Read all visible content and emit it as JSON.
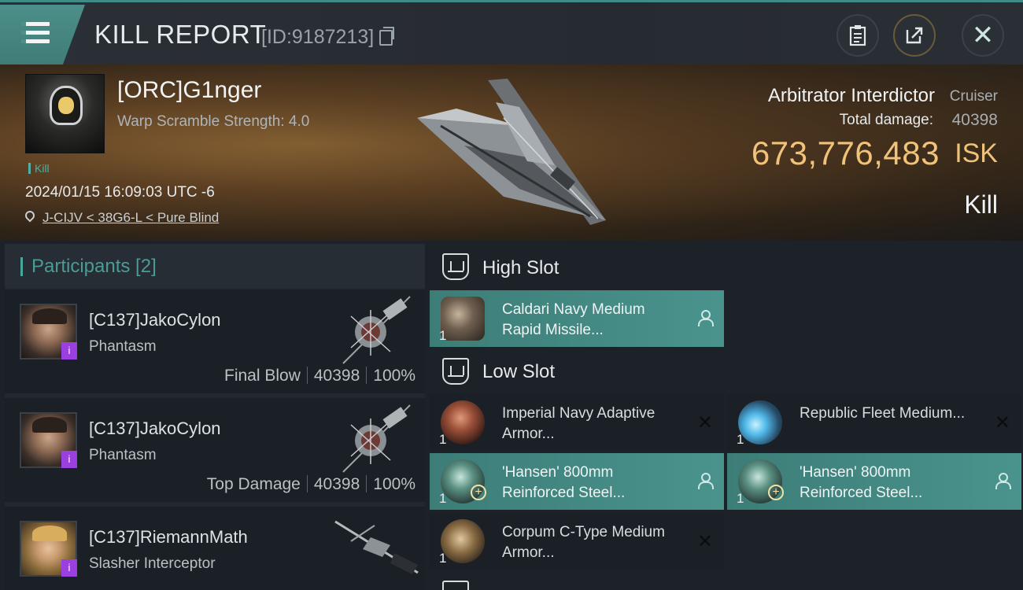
{
  "header": {
    "title": "KILL REPORT",
    "report_id": "[ID:9187213]",
    "close_glyph": "✕"
  },
  "hero": {
    "pilot_name": "[ORC]G1nger",
    "warp_scramble": "Warp Scramble Strength: 4.0",
    "kill_tag": "Kill",
    "datetime": "2024/01/15 16:09:03 UTC -6",
    "location": "J-CIJV < 38G6-L < Pure Blind",
    "ship_name": "Arbitrator Interdictor",
    "ship_class": "Cruiser",
    "total_damage_label": "Total damage:",
    "total_damage": "40398",
    "isk_value": "673,776,483",
    "isk_unit": "ISK",
    "status": "Kill"
  },
  "participants": {
    "title": "Participants [2]",
    "items": [
      {
        "name": "[C137]JakoCylon",
        "ship": "Phantasm",
        "role": "Final Blow",
        "damage": "40398",
        "percent": "100%"
      },
      {
        "name": "[C137]JakoCylon",
        "ship": "Phantasm",
        "role": "Top Damage",
        "damage": "40398",
        "percent": "100%"
      },
      {
        "name": "[C137]RiemannMath",
        "ship": "Slasher Interceptor",
        "role": "",
        "damage": "",
        "percent": ""
      }
    ]
  },
  "fitting": {
    "high_slot": {
      "title": "High Slot",
      "modules": [
        {
          "name": "Caldari Navy Medium Rapid Missile...",
          "qty": "1",
          "state": "dropped"
        }
      ]
    },
    "low_slot": {
      "title": "Low Slot",
      "modules": [
        {
          "name": "Imperial Navy Adaptive Armor...",
          "qty": "1",
          "state": "destroyed"
        },
        {
          "name": "Republic Fleet Medium...",
          "qty": "1",
          "state": "destroyed"
        },
        {
          "name": "'Hansen' 800mm Reinforced Steel...",
          "qty": "1",
          "state": "dropped"
        },
        {
          "name": "'Hansen' 800mm Reinforced Steel...",
          "qty": "1",
          "state": "dropped"
        },
        {
          "name": "Corpum C-Type Medium Armor...",
          "qty": "1",
          "state": "destroyed"
        }
      ]
    }
  },
  "icons": {
    "menu": "menu-icon",
    "clipboard": "clipboard-icon",
    "share": "share-icon",
    "close": "close-icon",
    "location": "location-pin-icon",
    "slot": "slot-icon",
    "dropped": "person-icon",
    "destroyed": "x-icon",
    "plus": "+",
    "x": "✕"
  },
  "colors": {
    "accent": "#4a938d",
    "isk": "#f0c27a",
    "badge": "#9a3fe0"
  }
}
